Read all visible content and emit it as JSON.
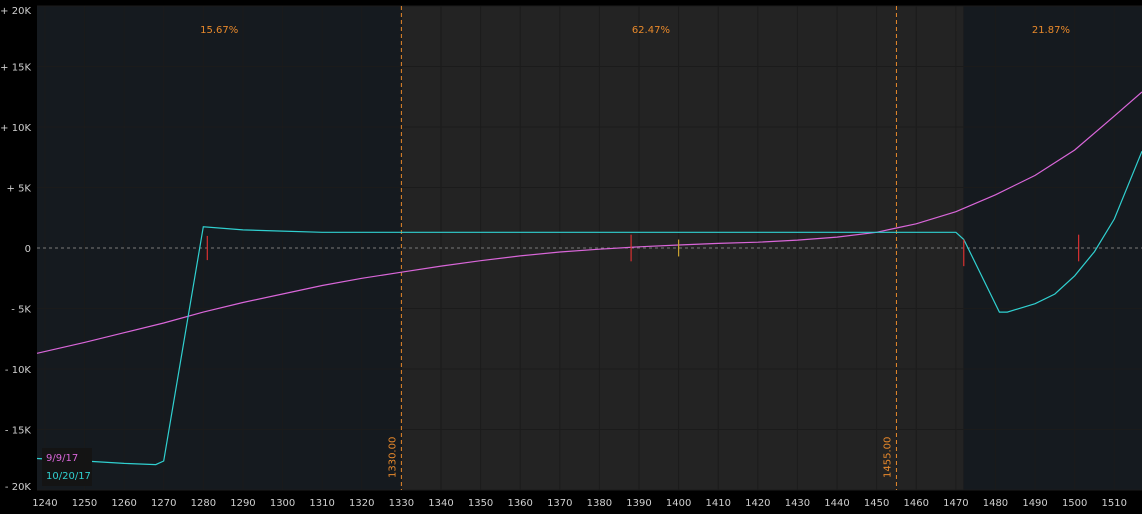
{
  "chart_data": {
    "type": "line",
    "xlim": [
      1238,
      1517
    ],
    "ylim": [
      -20000,
      20000
    ],
    "x_ticks": [
      1240,
      1250,
      1260,
      1270,
      1280,
      1290,
      1300,
      1310,
      1320,
      1330,
      1340,
      1350,
      1360,
      1370,
      1380,
      1390,
      1400,
      1410,
      1420,
      1430,
      1440,
      1450,
      1460,
      1470,
      1480,
      1490,
      1500,
      1510
    ],
    "y_ticks": [
      {
        "value": 20000,
        "label": "+ 20K"
      },
      {
        "value": 15000,
        "label": "+ 15K"
      },
      {
        "value": 10000,
        "label": "+ 10K"
      },
      {
        "value": 5000,
        "label": "+ 5K"
      },
      {
        "value": 0,
        "label": "0"
      },
      {
        "value": -5000,
        "label": "- 5K"
      },
      {
        "value": -10000,
        "label": "- 10K"
      },
      {
        "value": -15000,
        "label": "- 15K"
      },
      {
        "value": -20000,
        "label": "- 20K"
      }
    ],
    "regions": [
      {
        "from": 1238,
        "to": 1330,
        "label": "15.67%",
        "color": "#151a1f"
      },
      {
        "from": 1330,
        "to": 1455,
        "label": "62.47%",
        "color": "#232323"
      },
      {
        "from": 1455,
        "to": 1472,
        "label": "",
        "color": "#232323"
      },
      {
        "from": 1472,
        "to": 1517,
        "label": "21.87%",
        "color": "#151a1f"
      }
    ],
    "region_label_positions": [
      1284,
      1393,
      1494
    ],
    "vertical_lines": [
      {
        "x": 1330,
        "label": "1330.00",
        "color": "#e8892b"
      },
      {
        "x": 1455,
        "label": "1455.00",
        "color": "#e8892b"
      }
    ],
    "series": [
      {
        "name": "9/9/17",
        "color": "#d966d9",
        "points": [
          [
            1238,
            -8700
          ],
          [
            1250,
            -7800
          ],
          [
            1260,
            -7000
          ],
          [
            1270,
            -6200
          ],
          [
            1280,
            -5300
          ],
          [
            1290,
            -4500
          ],
          [
            1300,
            -3800
          ],
          [
            1310,
            -3100
          ],
          [
            1320,
            -2500
          ],
          [
            1330,
            -2000
          ],
          [
            1340,
            -1500
          ],
          [
            1350,
            -1050
          ],
          [
            1360,
            -650
          ],
          [
            1370,
            -330
          ],
          [
            1380,
            -100
          ],
          [
            1390,
            100
          ],
          [
            1400,
            250
          ],
          [
            1410,
            380
          ],
          [
            1420,
            480
          ],
          [
            1430,
            650
          ],
          [
            1440,
            900
          ],
          [
            1450,
            1300
          ],
          [
            1455,
            1650
          ],
          [
            1460,
            2000
          ],
          [
            1470,
            3000
          ],
          [
            1480,
            4400
          ],
          [
            1490,
            6000
          ],
          [
            1500,
            8100
          ],
          [
            1510,
            10900
          ],
          [
            1517,
            12900
          ]
        ]
      },
      {
        "name": "10/20/17",
        "color": "#30d0d0",
        "points": [
          [
            1238,
            -17400
          ],
          [
            1250,
            -17600
          ],
          [
            1260,
            -17800
          ],
          [
            1268,
            -17900
          ],
          [
            1270,
            -17600
          ],
          [
            1280,
            1750
          ],
          [
            1290,
            1500
          ],
          [
            1300,
            1400
          ],
          [
            1310,
            1300
          ],
          [
            1330,
            1300
          ],
          [
            1400,
            1300
          ],
          [
            1450,
            1300
          ],
          [
            1470,
            1300
          ],
          [
            1472,
            700
          ],
          [
            1481,
            -5300
          ],
          [
            1483,
            -5300
          ],
          [
            1490,
            -4600
          ],
          [
            1495,
            -3800
          ],
          [
            1500,
            -2300
          ],
          [
            1505,
            -300
          ],
          [
            1510,
            2400
          ],
          [
            1517,
            8000
          ]
        ]
      }
    ],
    "markers": [
      {
        "x": 1281,
        "y": 0,
        "color": "#d93030",
        "size": 1000
      },
      {
        "x": 1388,
        "y": 0,
        "color": "#d93030",
        "size": 1100
      },
      {
        "x": 1400,
        "y": 0,
        "color": "#c8a030",
        "size": 700
      },
      {
        "x": 1472,
        "y": -400,
        "color": "#d93030",
        "size": 1100
      },
      {
        "x": 1501,
        "y": 0,
        "color": "#d93030",
        "size": 1100
      }
    ],
    "zero_line_color": "#7a7a7a",
    "legend": {
      "placement": "bottom-left",
      "entries": [
        "9/9/17",
        "10/20/17"
      ]
    }
  }
}
